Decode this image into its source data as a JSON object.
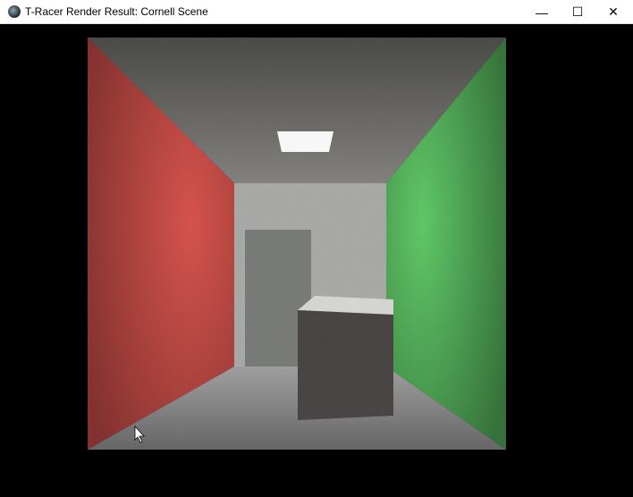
{
  "window": {
    "title": "T-Racer Render Result: Cornell Scene",
    "minimize_glyph": "—",
    "maximize_glyph": "☐",
    "close_glyph": "✕"
  },
  "colors": {
    "left_wall": "#b8302c",
    "right_wall": "#3fa644",
    "white_surfaces": "#9a9a9a",
    "background": "#000000"
  }
}
